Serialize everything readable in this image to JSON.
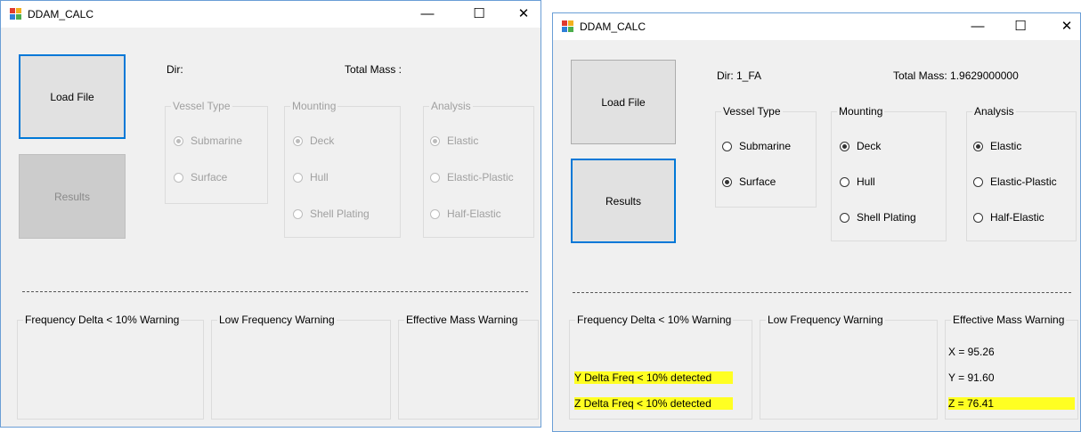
{
  "left": {
    "title": "DDAM_CALC",
    "load_file": "Load File",
    "results": "Results",
    "dir_label": "Dir:",
    "total_mass_label": "Total Mass :",
    "vessel_type": {
      "legend": "Vessel Type",
      "options": [
        "Submarine",
        "Surface"
      ]
    },
    "mounting": {
      "legend": "Mounting",
      "options": [
        "Deck",
        "Hull",
        "Shell Plating"
      ]
    },
    "analysis": {
      "legend": "Analysis",
      "options": [
        "Elastic",
        "Elastic-Plastic",
        "Half-Elastic"
      ]
    },
    "freq_delta_group": "Frequency Delta < 10% Warning",
    "low_freq_group": "Low Frequency Warning",
    "eff_mass_group": "Effective Mass Warning"
  },
  "right": {
    "title": "DDAM_CALC",
    "load_file": "Load File",
    "results": "Results",
    "dir_label": "Dir: 1_FA",
    "total_mass_label": "Total Mass: 1.9629000000",
    "vessel_type": {
      "legend": "Vessel Type",
      "options": [
        "Submarine",
        "Surface"
      ]
    },
    "mounting": {
      "legend": "Mounting",
      "options": [
        "Deck",
        "Hull",
        "Shell Plating"
      ]
    },
    "analysis": {
      "legend": "Analysis",
      "options": [
        "Elastic",
        "Elastic-Plastic",
        "Half-Elastic"
      ]
    },
    "freq_delta_group": "Frequency Delta < 10% Warning",
    "low_freq_group": "Low Frequency Warning",
    "eff_mass_group": "Effective Mass Warning",
    "freq_warnings": [
      "Y Delta Freq < 10% detected",
      "Z Delta Freq < 10% detected"
    ],
    "mass_values": [
      "X = 95.26",
      "Y = 91.60",
      "Z = 76.41"
    ]
  },
  "colors": {
    "focus_border": "#0078d7",
    "highlight": "#ffff22",
    "window_bg": "#f0f0f0"
  }
}
